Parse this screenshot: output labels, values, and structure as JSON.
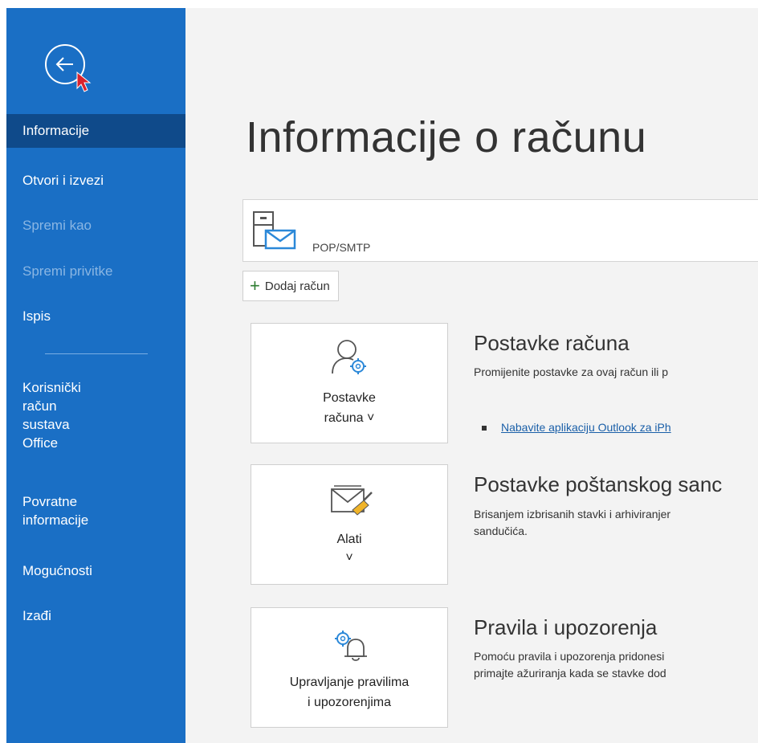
{
  "sidebar": {
    "items": [
      {
        "label": "Informacije"
      },
      {
        "label": "Otvori i izvezi"
      },
      {
        "label": "Spremi kao"
      },
      {
        "label": "Spremi privitke"
      },
      {
        "label": "Ispis"
      },
      {
        "lines": [
          "Korisnički",
          "račun",
          "sustava",
          "Office"
        ]
      },
      {
        "lines": [
          "Povratne",
          "informacije"
        ]
      },
      {
        "label": "Mogućnosti"
      },
      {
        "label": "Izađi"
      }
    ]
  },
  "main": {
    "title": "Informacije o računu",
    "account": {
      "type": "POP/SMTP",
      "icon": "mailbox-icon"
    },
    "add_account_label": "Dodaj račun",
    "sections": [
      {
        "card_lines": [
          "Postavke",
          "računa ˅"
        ],
        "title": "Postavke računa",
        "desc": "Promijenite postavke za ovaj račun ili p",
        "link": "Nabavite aplikaciju Outlook za iPh"
      },
      {
        "card_lines": [
          "Alati",
          "˅"
        ],
        "title": "Postavke poštanskog sanc",
        "desc_lines": [
          "Brisanjem izbrisanih stavki i arhiviranjer",
          "sandučića."
        ]
      },
      {
        "card_lines": [
          "Upravljanje pravilima",
          "i upozorenjima"
        ],
        "title": "Pravila i upozorenja",
        "desc_lines": [
          "Pomoću pravila i upozorenja pridonesi",
          "primajte ažuriranja kada se stavke dod"
        ]
      }
    ]
  },
  "colors": {
    "sidebar": "#1a6fc5",
    "sidebar_active": "#0f4a8a",
    "link": "#1a5fa8"
  }
}
